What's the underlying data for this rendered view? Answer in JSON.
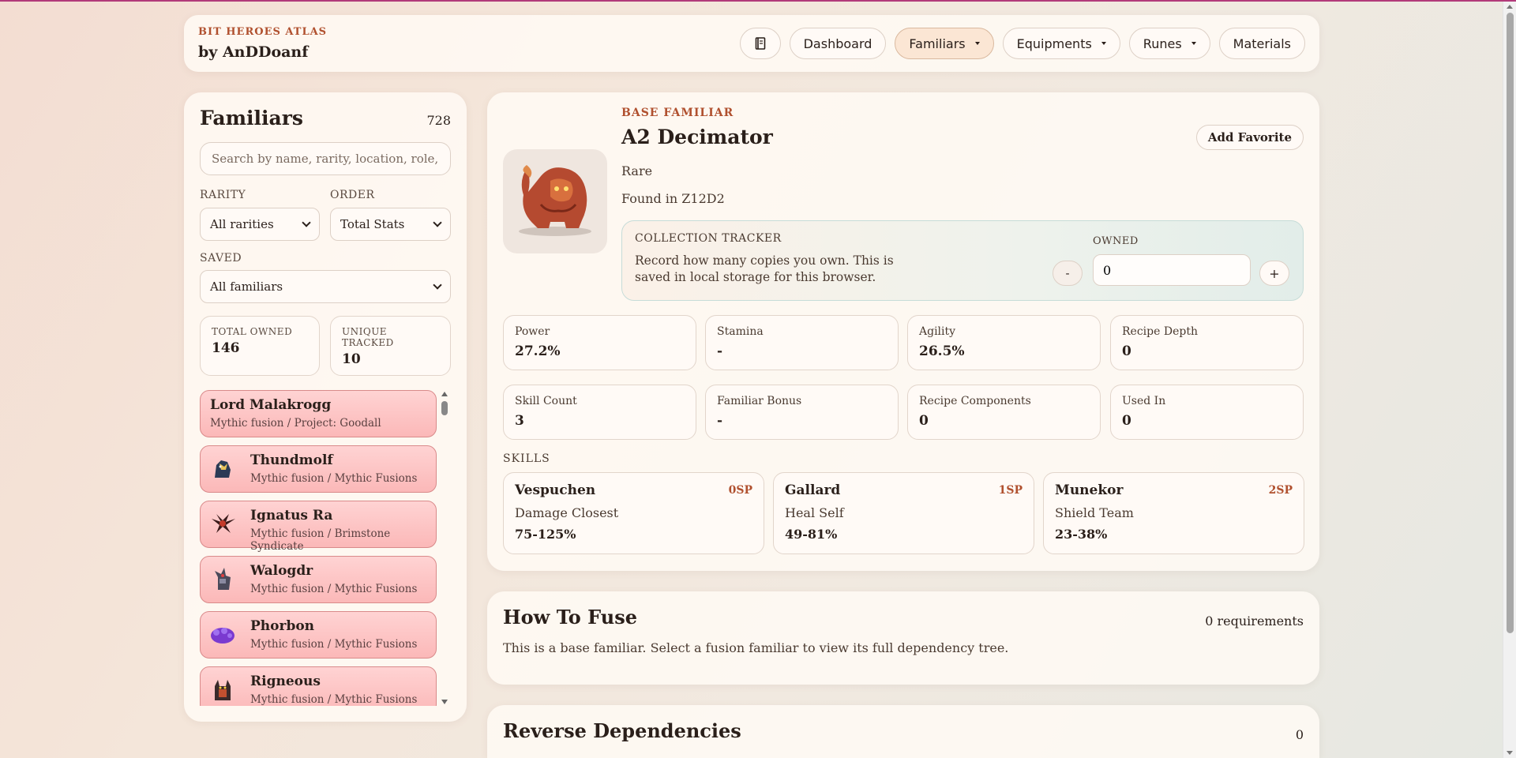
{
  "header": {
    "kicker": "BIT HEROES ATLAS",
    "author": "by AnDDoanf",
    "nav": [
      {
        "label": "",
        "icon": "book-icon"
      },
      {
        "label": "Dashboard"
      },
      {
        "label": "Familiars",
        "active": true,
        "dropdown": true
      },
      {
        "label": "Equipments",
        "dropdown": true
      },
      {
        "label": "Runes",
        "dropdown": true
      },
      {
        "label": "Materials"
      }
    ]
  },
  "sidebar": {
    "title": "Familiars",
    "count": "728",
    "search_placeholder": "Search by name, rarity, location, role, or skill",
    "rarity_label": "RARITY",
    "rarity_value": "All rarities",
    "order_label": "ORDER",
    "order_value": "Total Stats",
    "saved_label": "SAVED",
    "saved_value": "All familiars",
    "total_owned_label": "TOTAL OWNED",
    "total_owned_value": "146",
    "unique_tracked_label": "UNIQUE TRACKED",
    "unique_tracked_value": "10",
    "items": [
      {
        "name": "Lord Malakrogg",
        "sub": "Mythic fusion / Project: Goodall",
        "icon": ""
      },
      {
        "name": "Thundmolf",
        "sub": "Mythic fusion / Mythic Fusions",
        "icon": "thundmolf-icon"
      },
      {
        "name": "Ignatus Ra",
        "sub": "Mythic fusion / Brimstone Syndicate",
        "icon": "ignatus-ra-icon"
      },
      {
        "name": "Walogdr",
        "sub": "Mythic fusion / Mythic Fusions",
        "icon": "walogdr-icon"
      },
      {
        "name": "Phorbon",
        "sub": "Mythic fusion / Mythic Fusions",
        "icon": "phorbon-icon"
      },
      {
        "name": "Rigneous",
        "sub": "Mythic fusion / Mythic Fusions",
        "icon": "rigneous-icon"
      }
    ]
  },
  "detail": {
    "kicker": "BASE FAMILIAR",
    "name": "A2 Decimator",
    "favorite_label": "Add Favorite",
    "rarity": "Rare",
    "location": "Found in Z12D2",
    "tracker": {
      "label": "COLLECTION TRACKER",
      "description": "Record how many copies you own. This is saved in local storage for this browser.",
      "owned_label": "OWNED",
      "owned_value": "0",
      "minus": "-",
      "plus": "+"
    },
    "stats": [
      {
        "label": "Power",
        "value": "27.2%"
      },
      {
        "label": "Stamina",
        "value": "-"
      },
      {
        "label": "Agility",
        "value": "26.5%"
      },
      {
        "label": "Recipe Depth",
        "value": "0"
      },
      {
        "label": "Skill Count",
        "value": "3"
      },
      {
        "label": "Familiar Bonus",
        "value": "-"
      },
      {
        "label": "Recipe Components",
        "value": "0"
      },
      {
        "label": "Used In",
        "value": "0"
      }
    ],
    "skills_label": "SKILLS",
    "skills": [
      {
        "name": "Vespuchen",
        "sp": "0SP",
        "type": "Damage Closest",
        "range": "75-125%"
      },
      {
        "name": "Gallard",
        "sp": "1SP",
        "type": "Heal Self",
        "range": "49-81%"
      },
      {
        "name": "Munekor",
        "sp": "2SP",
        "type": "Shield Team",
        "range": "23-38%"
      }
    ]
  },
  "fuse": {
    "title": "How To Fuse",
    "count": "0 requirements",
    "description": "This is a base familiar. Select a fusion familiar to view its full dependency tree."
  },
  "reverse": {
    "title": "Reverse Dependencies",
    "count": "0"
  },
  "colors": {
    "accent": "#b0502e",
    "active_nav": "#fbe6d4",
    "mythic_item": "#fbb8b8"
  }
}
